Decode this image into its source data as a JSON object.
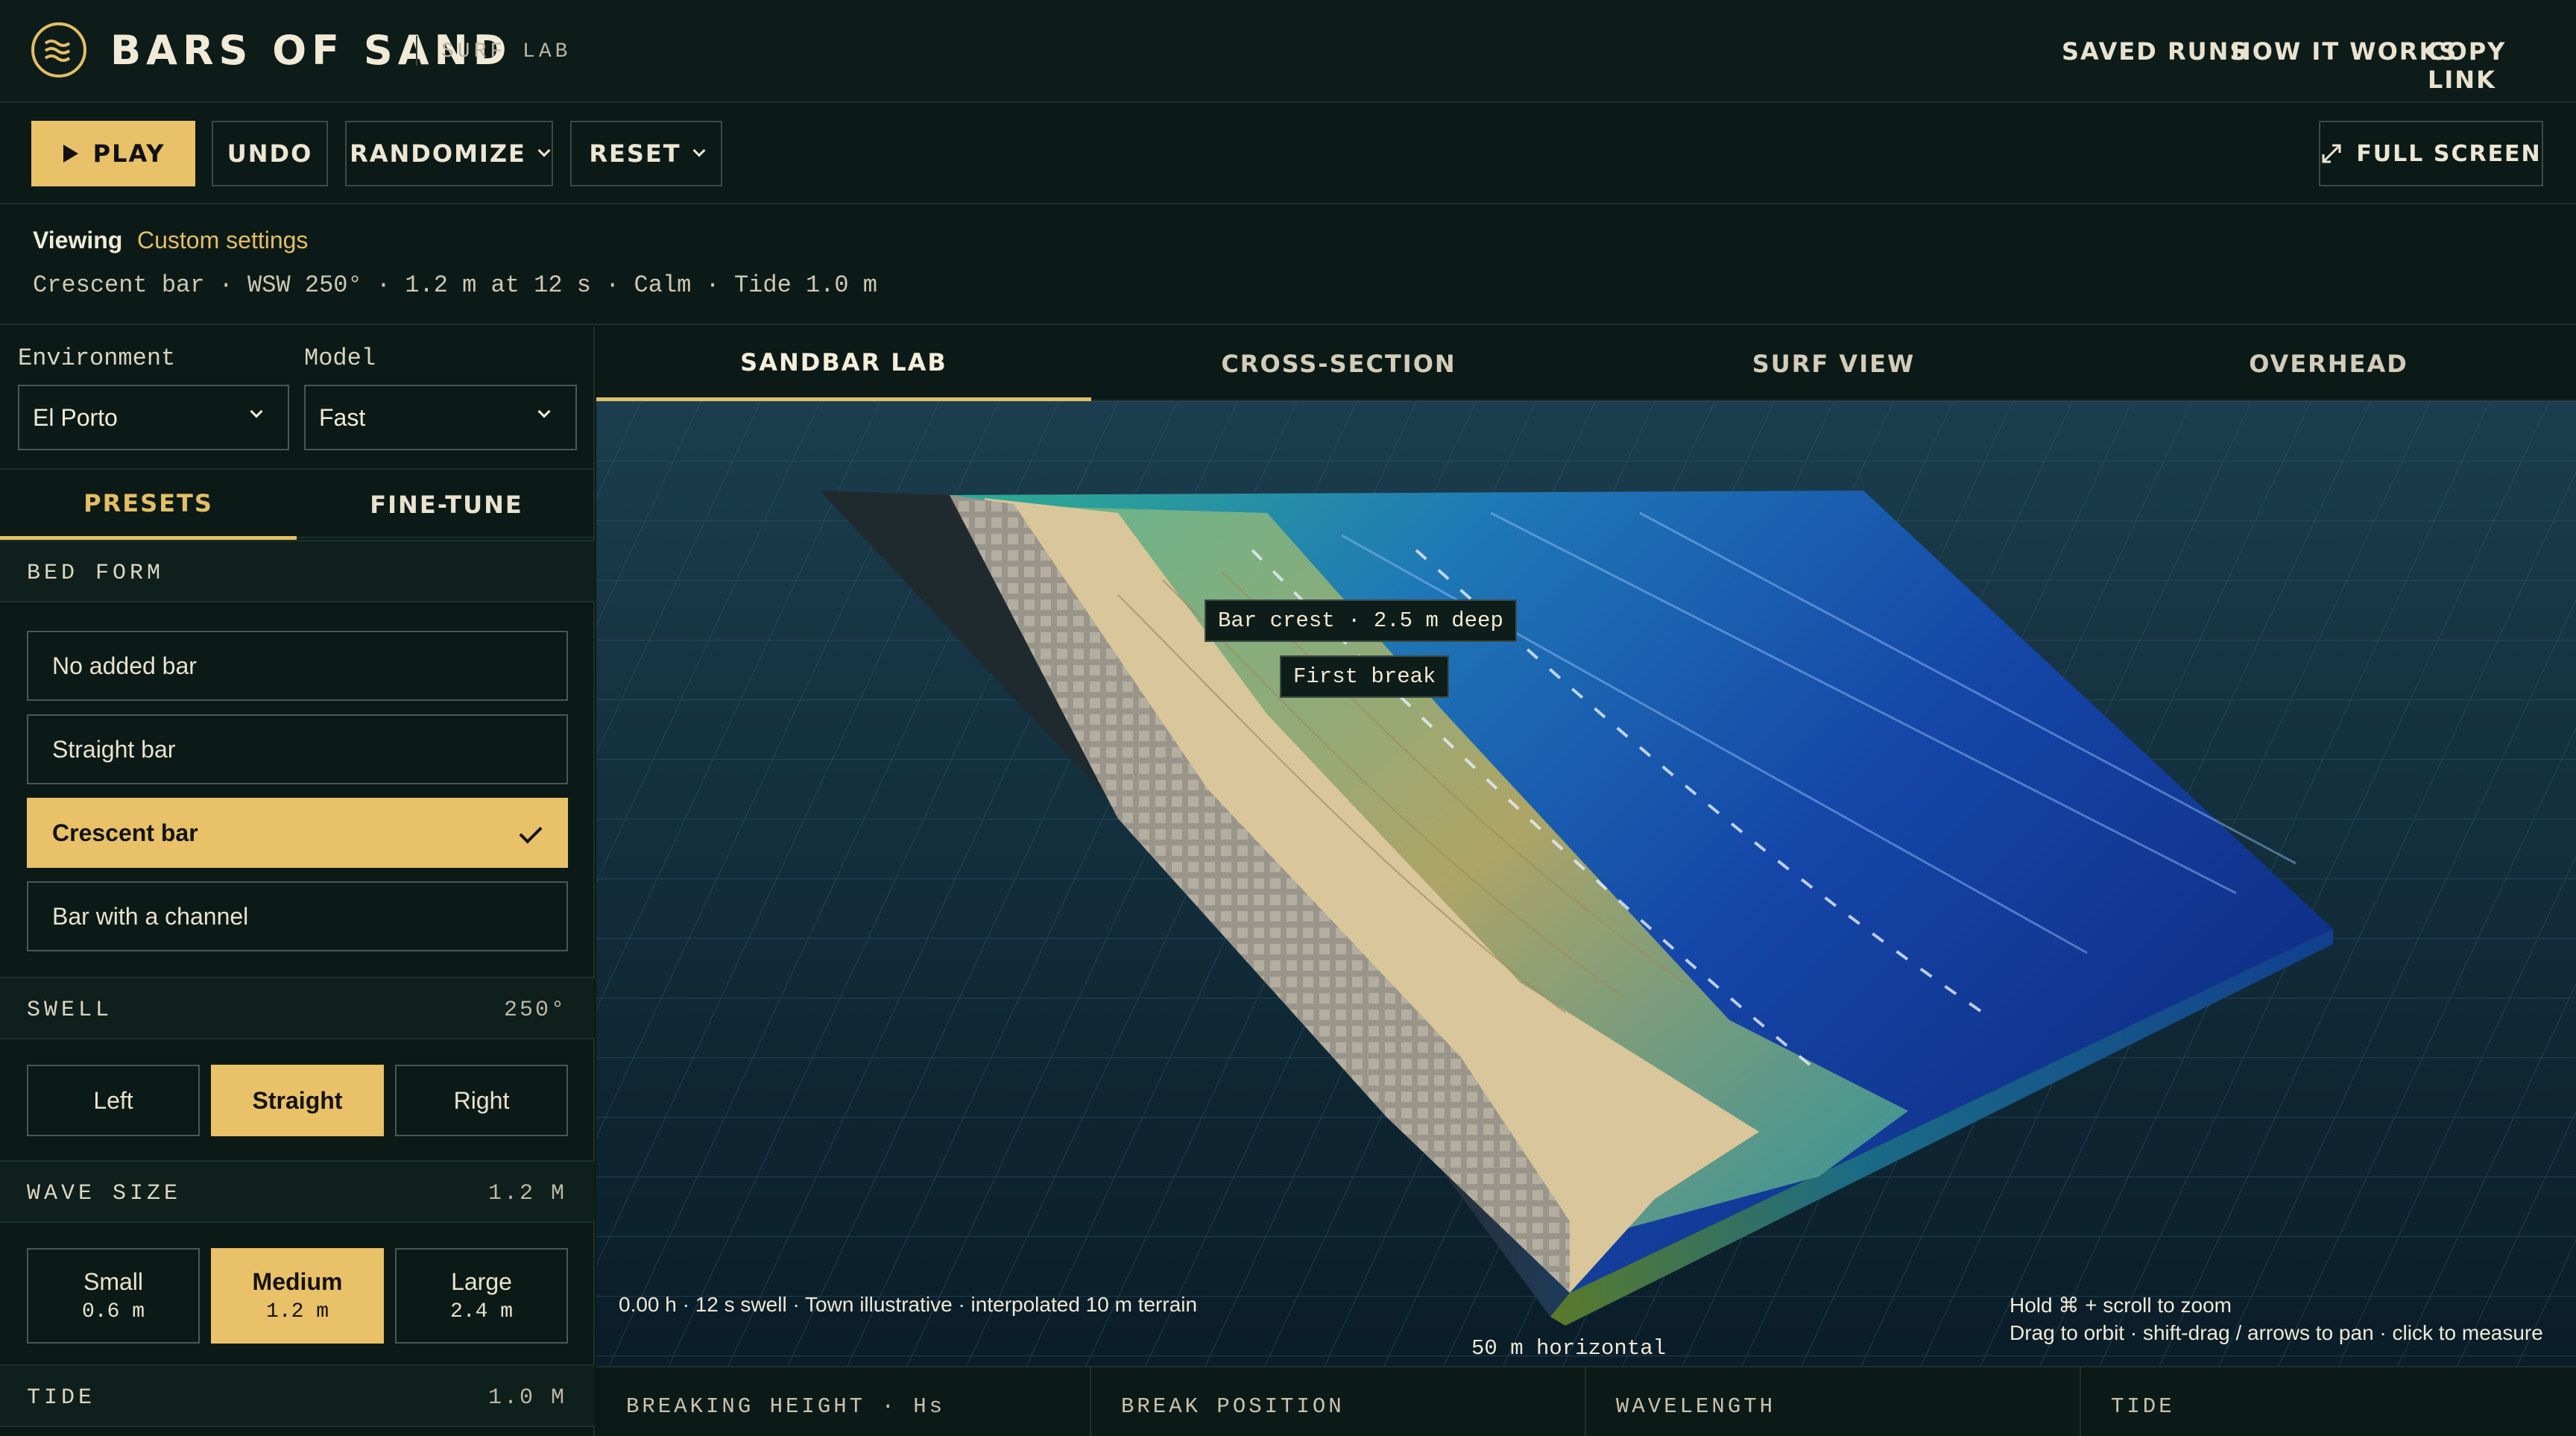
{
  "app": {
    "brand": "BARS OF SAND",
    "subtitle": "SURF LAB",
    "accent": "#e8c168"
  },
  "topnav": [
    "SAVED RUNS",
    "HOW IT WORKS",
    "COPY LINK"
  ],
  "toolbar": {
    "play": "PLAY",
    "undo": "UNDO",
    "randomize": "RANDOMIZE",
    "reset": "RESET",
    "fullscreen": "FULL SCREEN"
  },
  "viewing": {
    "label": "Viewing",
    "value": "Custom settings",
    "summary": "Crescent bar · WSW 250° · 1.2 m at 12 s · Calm · Tide 1.0 m"
  },
  "sidebar": {
    "environment": {
      "label": "Environment",
      "value": "El Porto"
    },
    "model": {
      "label": "Model",
      "value": "Fast"
    },
    "tabs": [
      "PRESETS",
      "FINE-TUNE"
    ],
    "bed_form": {
      "title": "BED FORM",
      "options": [
        "No added bar",
        "Straight bar",
        "Crescent bar",
        "Bar with a channel"
      ],
      "selected": "Crescent bar"
    },
    "swell": {
      "title": "SWELL",
      "value": "250°",
      "options": [
        "Left",
        "Straight",
        "Right"
      ],
      "selected": "Straight"
    },
    "wave_size": {
      "title": "WAVE SIZE",
      "value": "1.2 M",
      "options": [
        {
          "label": "Small",
          "sub": "0.6 m"
        },
        {
          "label": "Medium",
          "sub": "1.2 m"
        },
        {
          "label": "Large",
          "sub": "2.4 m"
        }
      ],
      "selected": "Medium"
    },
    "tide": {
      "title": "TIDE",
      "value": "1.0 M"
    }
  },
  "views": {
    "tabs": [
      "SANDBAR LAB",
      "CROSS-SECTION",
      "SURF VIEW",
      "OVERHEAD"
    ],
    "active": "SANDBAR LAB"
  },
  "scene": {
    "tooltip_bar": "Bar crest · 2.5 m deep",
    "tooltip_break": "First break",
    "status": "0.00 h · 12 s swell · Town illustrative · interpolated 10 m terrain",
    "scale": "50 m horizontal",
    "help_zoom": "Hold ⌘ + scroll to zoom",
    "help_nav": "Drag to orbit · shift-drag / arrows to pan · click to measure"
  },
  "metrics": [
    "BREAKING HEIGHT · Hs",
    "BREAK POSITION",
    "WAVELENGTH",
    "TIDE"
  ]
}
